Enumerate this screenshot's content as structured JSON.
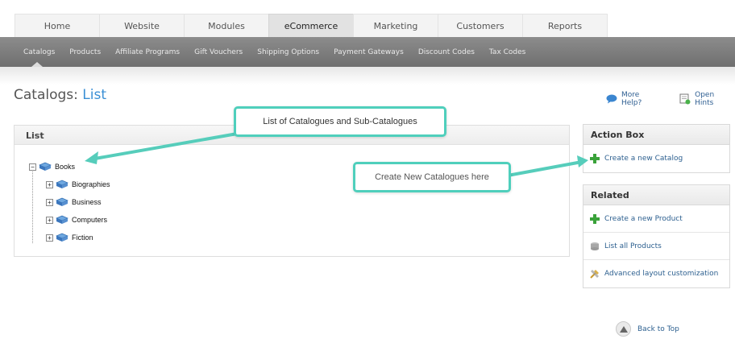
{
  "top_tabs": [
    {
      "label": "Home"
    },
    {
      "label": "Website"
    },
    {
      "label": "Modules"
    },
    {
      "label": "eCommerce",
      "active": true
    },
    {
      "label": "Marketing"
    },
    {
      "label": "Customers"
    },
    {
      "label": "Reports"
    }
  ],
  "sub_nav": [
    "Catalogs",
    "Products",
    "Affiliate Programs",
    "Gift Vouchers",
    "Shipping Options",
    "Payment Gateways",
    "Discount Codes",
    "Tax Codes"
  ],
  "page": {
    "title_prefix": "Catalogs:",
    "title_accent": "List"
  },
  "help": {
    "more_help": "More Help?",
    "open_hints": "Open Hints"
  },
  "list": {
    "heading": "List",
    "root": "Books",
    "children": [
      "Biographies",
      "Business",
      "Computers",
      "Fiction"
    ]
  },
  "action_box": {
    "heading": "Action Box",
    "create_catalog": "Create a new Catalog"
  },
  "related": {
    "heading": "Related",
    "create_product": "Create a new Product",
    "list_products": "List all Products",
    "advanced_layout": "Advanced layout customization"
  },
  "callouts": {
    "list_note": "List of Catalogues and Sub-Catalogues",
    "create_note": "Create New Catalogues here"
  },
  "back_to_top": "Back to Top",
  "colors": {
    "accent": "#3a8fd5",
    "callout_border": "#4fcfbc",
    "link": "#2c5f8f"
  }
}
